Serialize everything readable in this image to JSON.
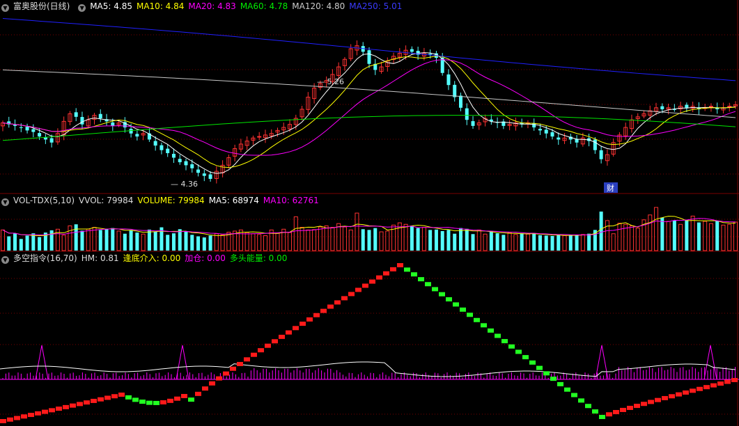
{
  "colors": {
    "up": "#ff3232",
    "down": "#54ffff",
    "ma5": "#ffffff",
    "ma10": "#ffff00",
    "ma20": "#ff00ff",
    "ma60": "#00e600",
    "ma120": "#c8c8c8",
    "ma250": "#2020ff",
    "grid": "#7a0000",
    "text": "#dddddd",
    "hm": "#ffffff",
    "bottom_line": "#ff00ff"
  },
  "legends": {
    "main": {
      "title": "富奥股份(日线)",
      "ma5": "MA5: 4.85",
      "ma10": "MA10: 4.84",
      "ma20": "MA20: 4.83",
      "ma60": "MA60: 4.78",
      "ma120": "MA120: 4.80",
      "ma250": "MA250: 5.01"
    },
    "vol": {
      "title": "VOL-TDX(5,10)",
      "vvol": "VVOL: 79984",
      "volume": "VOLUME: 79984",
      "ma5": "MA5: 68974",
      "ma10": "MA10: 62761"
    },
    "ind": {
      "title": "多空指令(16,70)",
      "hm": "HM: 0.81",
      "dd": "逢底介入: 0.00",
      "jc": "加仓: 0.00",
      "dt": "多头能量: 0.00"
    }
  },
  "annotations": {
    "high": "5.26",
    "low": "4.36",
    "cai": "财"
  },
  "chart_data": [
    {
      "type": "candlestick",
      "title": "富奥股份(日线)",
      "high_label": 5.26,
      "low_label": 4.36,
      "ylim": [
        4.3,
        5.45
      ],
      "close": [
        4.73,
        4.72,
        4.71,
        4.7,
        4.68,
        4.67,
        4.64,
        4.62,
        4.6,
        4.66,
        4.74,
        4.79,
        4.77,
        4.72,
        4.75,
        4.78,
        4.76,
        4.74,
        4.71,
        4.73,
        4.7,
        4.66,
        4.64,
        4.66,
        4.62,
        4.58,
        4.55,
        4.53,
        4.5,
        4.47,
        4.45,
        4.43,
        4.4,
        4.38,
        4.36,
        4.41,
        4.45,
        4.5,
        4.56,
        4.59,
        4.61,
        4.63,
        4.64,
        4.65,
        4.66,
        4.68,
        4.7,
        4.72,
        4.76,
        4.82,
        4.9,
        4.96,
        4.99,
        5.01,
        5.05,
        5.1,
        5.15,
        5.22,
        5.24,
        5.2,
        5.12,
        5.08,
        5.1,
        5.14,
        5.17,
        5.19,
        5.21,
        5.2,
        5.18,
        5.19,
        5.18,
        5.16,
        5.06,
        4.98,
        4.9,
        4.83,
        4.75,
        4.71,
        4.73,
        4.76,
        4.74,
        4.73,
        4.71,
        4.72,
        4.73,
        4.72,
        4.73,
        4.7,
        4.68,
        4.66,
        4.64,
        4.62,
        4.63,
        4.62,
        4.6,
        4.63,
        4.61,
        4.55,
        4.49,
        4.52,
        4.6,
        4.65,
        4.7,
        4.75,
        4.77,
        4.79,
        4.81,
        4.83,
        4.82,
        4.83,
        4.82,
        4.84,
        4.83,
        4.84,
        4.82,
        4.83,
        4.84,
        4.82,
        4.83,
        4.84,
        4.85
      ],
      "ma5_last": 4.85,
      "ma10_last": 4.84,
      "ma20_last": 4.83,
      "ma60_last": 4.78,
      "ma120_last": 4.8,
      "ma250_last": 5.01
    },
    {
      "type": "bar",
      "title": "VOL-TDX(5,10)",
      "values": [
        55,
        38,
        46,
        31,
        40,
        46,
        36,
        48,
        54,
        57,
        41,
        66,
        70,
        53,
        57,
        62,
        55,
        58,
        60,
        52,
        45,
        55,
        48,
        44,
        56,
        50,
        62,
        42,
        46,
        57,
        52,
        42,
        38,
        35,
        40,
        45,
        42,
        49,
        52,
        55,
        48,
        45,
        43,
        40,
        55,
        46,
        57,
        48,
        90,
        62,
        55,
        56,
        63,
        66,
        62,
        72,
        63,
        55,
        100,
        57,
        55,
        60,
        50,
        52,
        68,
        74,
        70,
        66,
        60,
        62,
        55,
        56,
        52,
        55,
        45,
        60,
        58,
        44,
        55,
        44,
        51,
        46,
        42,
        48,
        43,
        46,
        44,
        45,
        41,
        40,
        39,
        42,
        40,
        42,
        41,
        43,
        45,
        55,
        104,
        80,
        45,
        73,
        70,
        66,
        60,
        82,
        95,
        115,
        88,
        78,
        80,
        70,
        82,
        92,
        75,
        78,
        72,
        80,
        68,
        70,
        76
      ],
      "vvol": 79984,
      "ma5_last": 68974,
      "ma10_last": 62761
    },
    {
      "type": "line",
      "title": "多空指令(16,70)",
      "hm_last": 0.81,
      "dd_last": 0.0,
      "jc_last": 0.0,
      "dt_last": 0.0
    }
  ]
}
